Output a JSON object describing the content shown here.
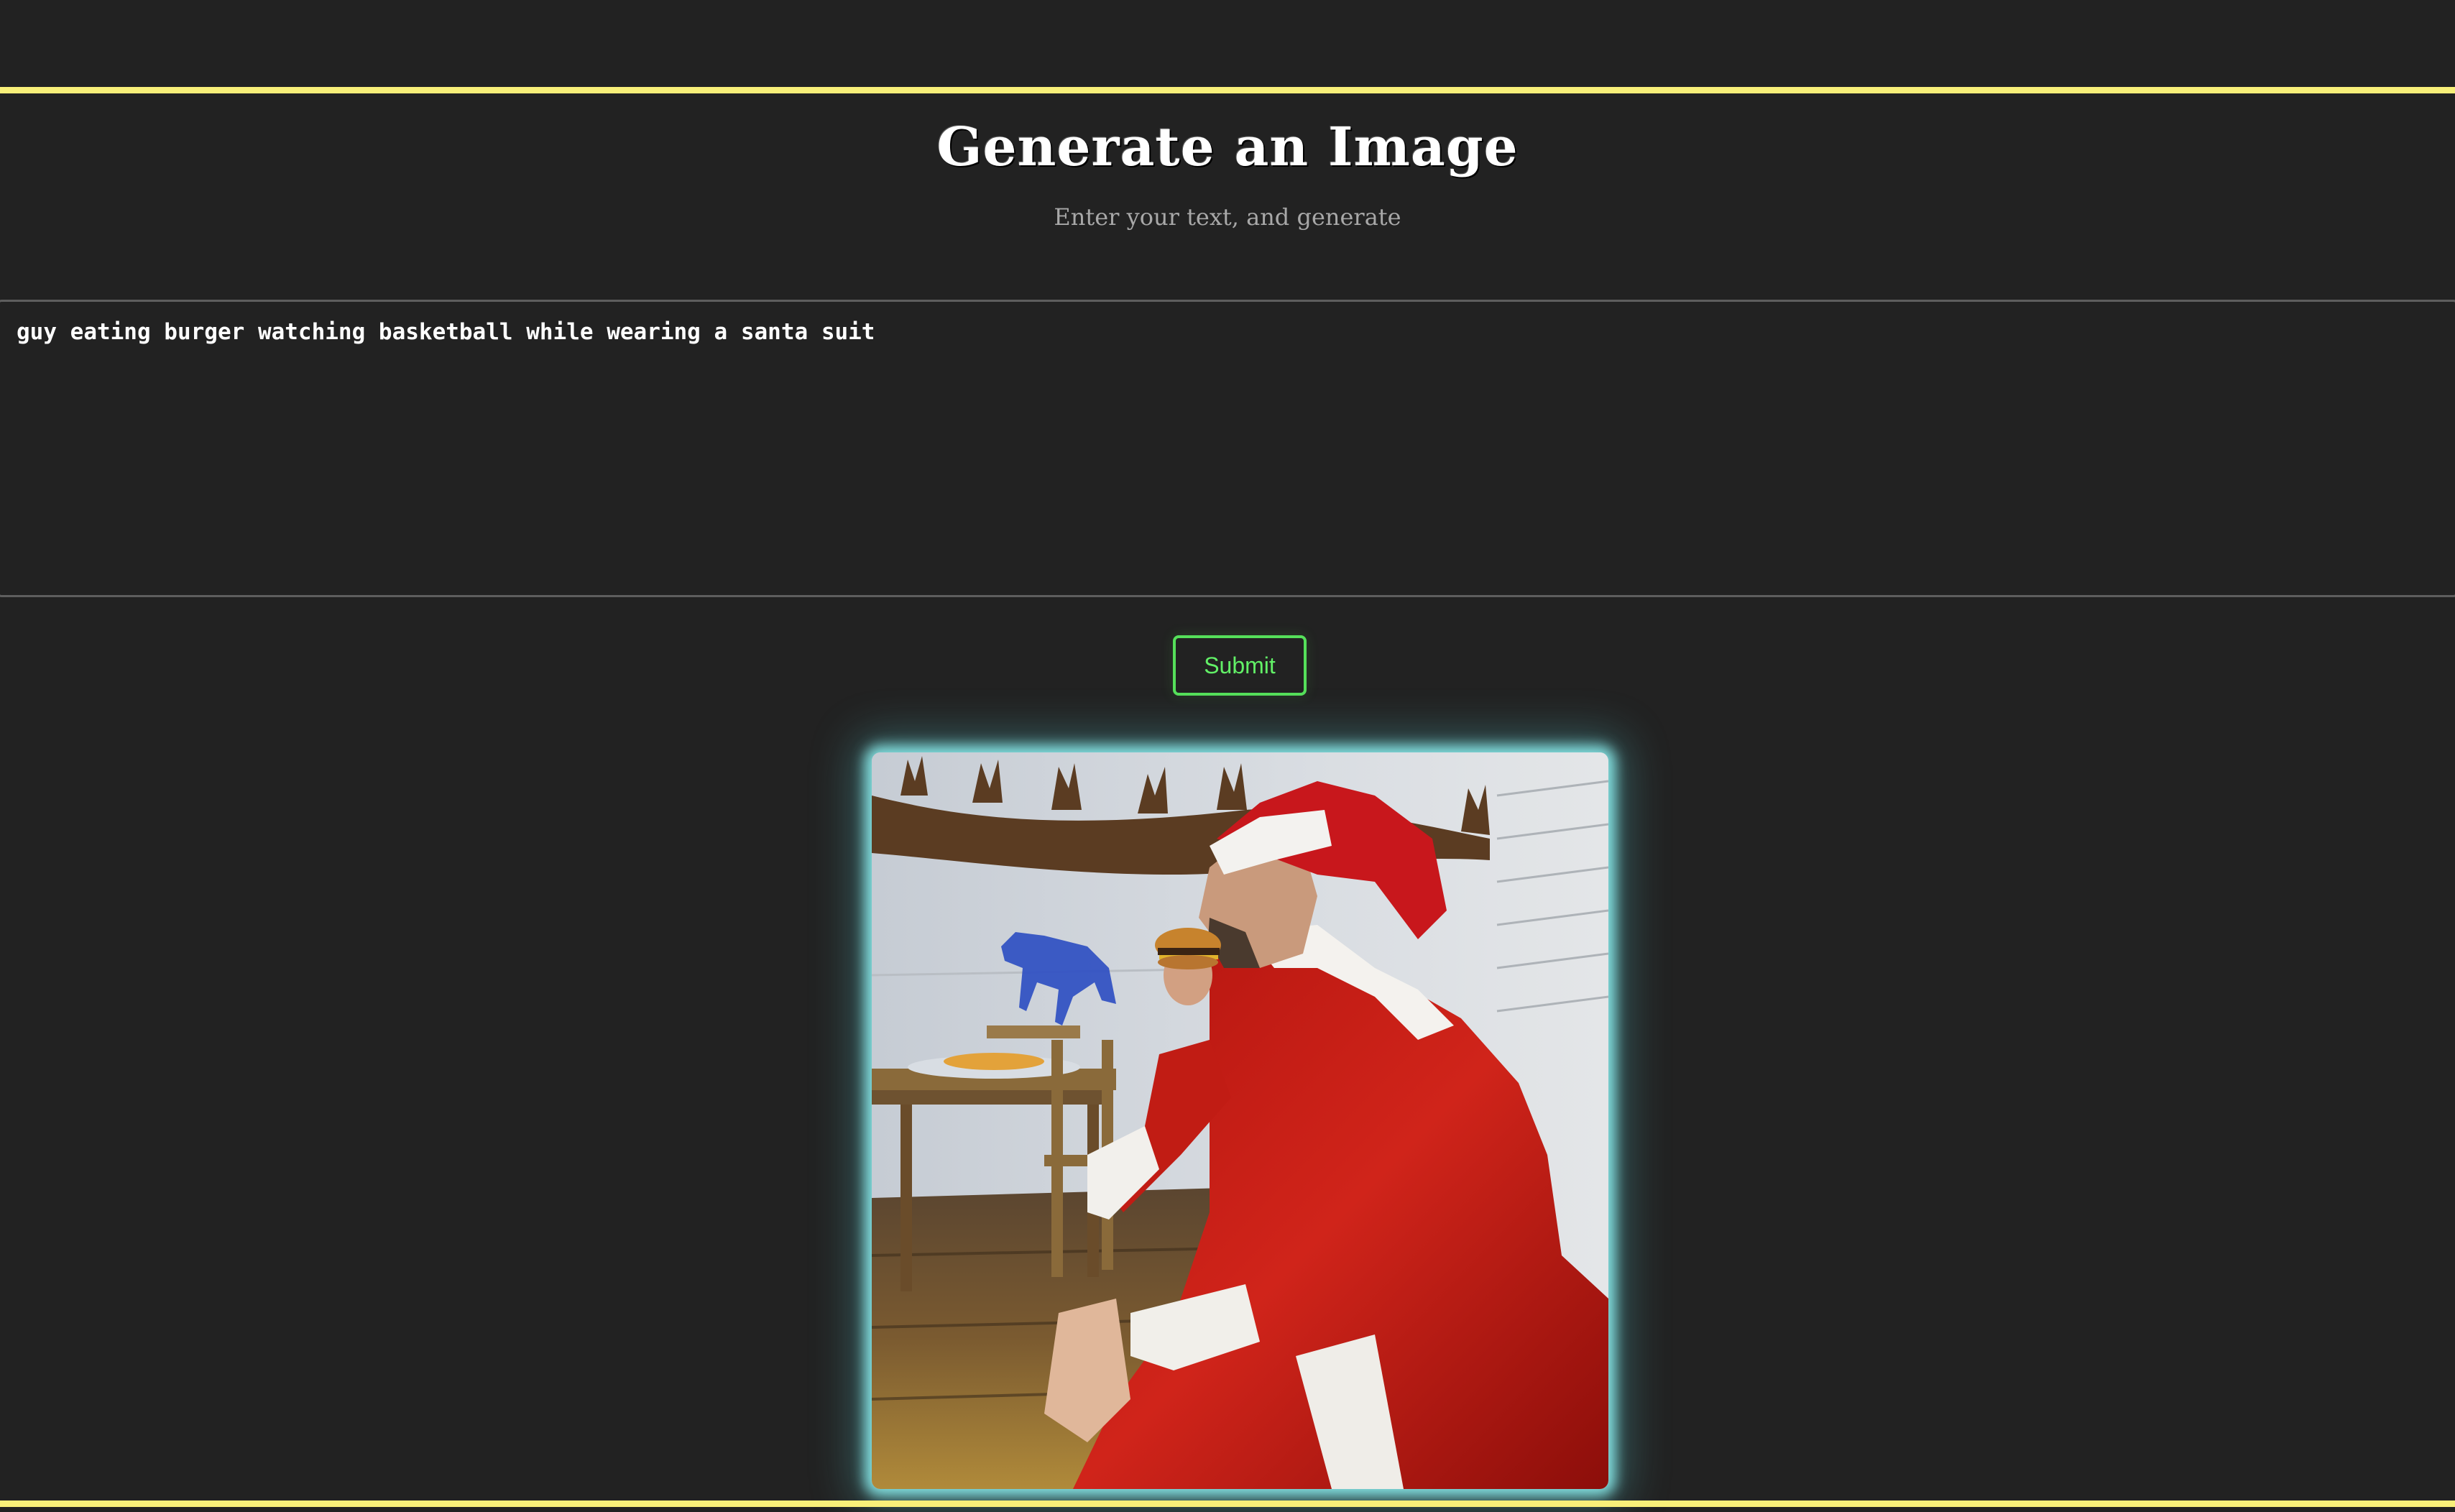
{
  "header": {
    "title": "Generate an Image",
    "subtitle": "Enter your text, and generate"
  },
  "prompt": {
    "value": "guy eating burger watching basketball while wearing a santa suit",
    "placeholder": ""
  },
  "actions": {
    "submit_label": "Submit"
  },
  "result": {
    "alt": "guy eating burger watching basketball while wearing a santa suit"
  },
  "colors": {
    "background": "#222222",
    "rule": "#f8ef79",
    "submit_accent": "#55e05a",
    "image_glow": "#8cf0f0"
  }
}
